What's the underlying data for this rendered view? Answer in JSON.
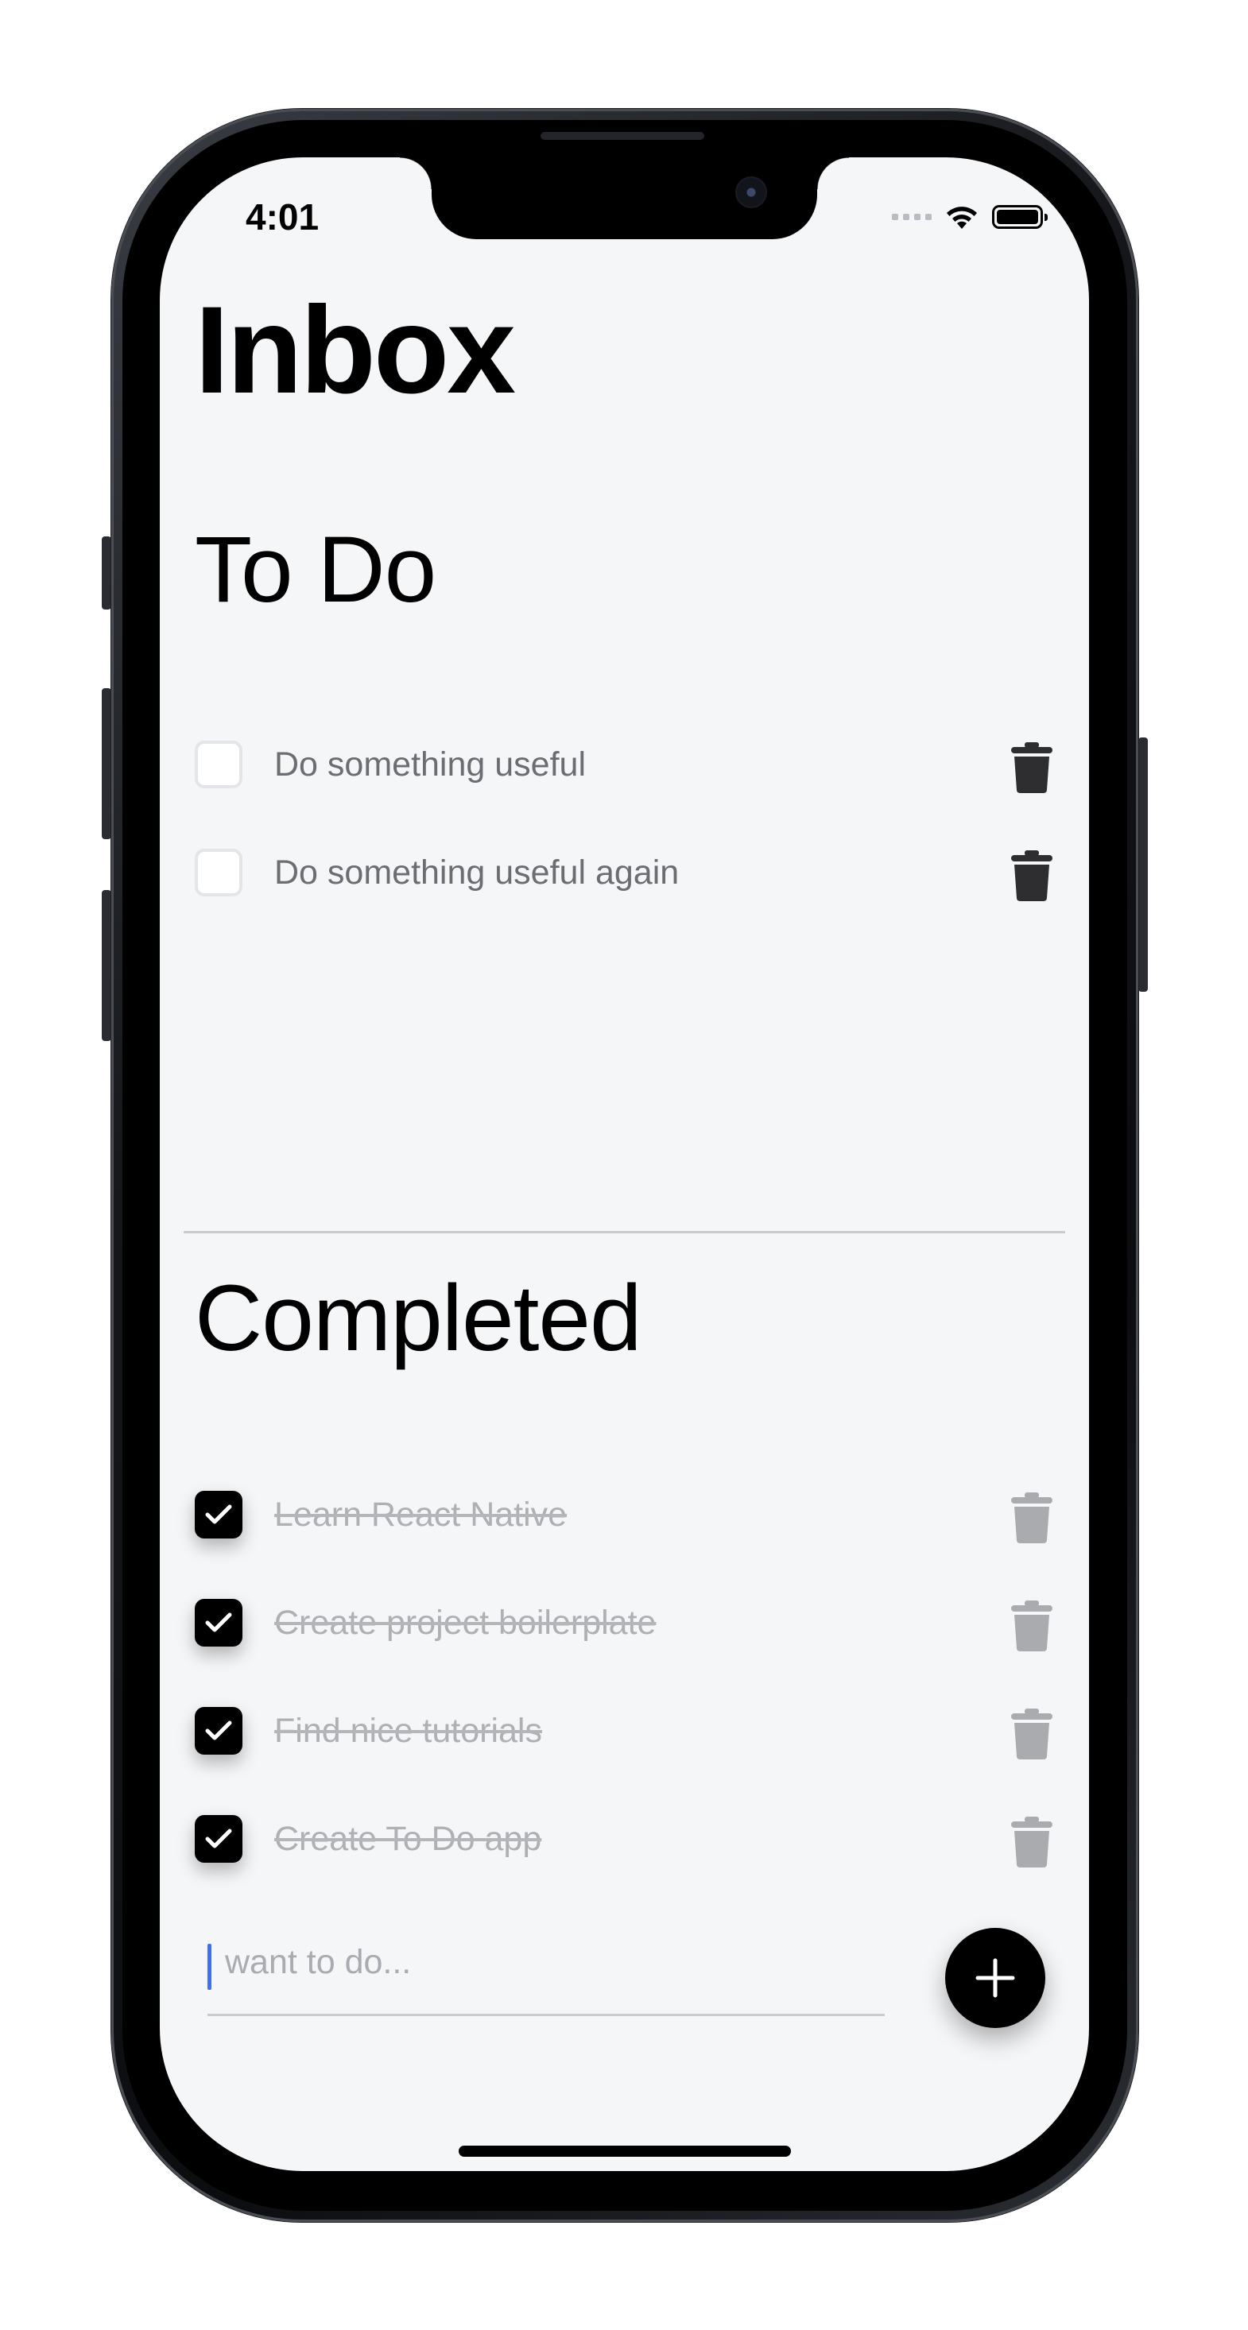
{
  "status_bar": {
    "time": "4:01"
  },
  "header": {
    "title": "Inbox"
  },
  "todo": {
    "title": "To Do",
    "items": [
      {
        "label": "Do something useful",
        "done": false
      },
      {
        "label": "Do something useful again",
        "done": false
      }
    ]
  },
  "completed": {
    "title": "Completed",
    "items": [
      {
        "label": "Learn React Native",
        "done": true
      },
      {
        "label": "Create project boilerplate",
        "done": true
      },
      {
        "label": "Find nice tutorials",
        "done": true
      },
      {
        "label": "Create To Do app",
        "done": true
      }
    ]
  },
  "new_task": {
    "value": "",
    "placeholder": "want to do..."
  },
  "colors": {
    "background": "#f5f6f8",
    "primary": "#000000",
    "todo_text": "#6b6d72",
    "done_text": "#aeb0b4",
    "trash_active": "#2e2e30",
    "trash_done": "#a9abae",
    "cursor": "#3d6ff0"
  },
  "icons": {
    "wifi": "wifi-icon",
    "battery": "battery-icon",
    "signal": "signal-icon",
    "trash": "trash-icon",
    "check": "checkmark-icon",
    "add": "plus-icon"
  }
}
